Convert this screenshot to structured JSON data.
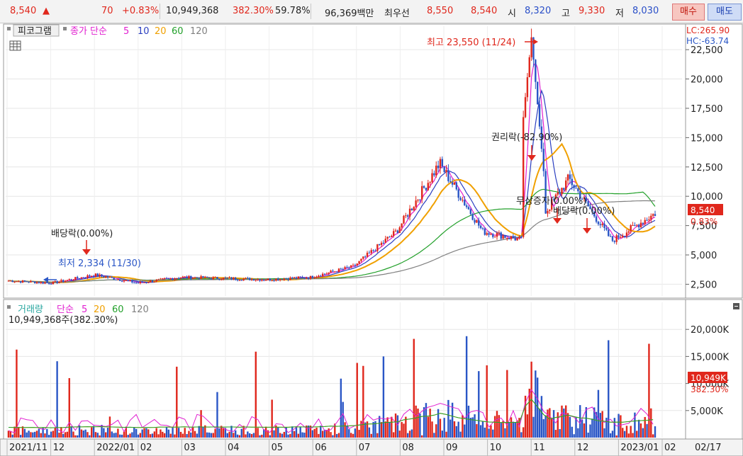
{
  "topbar": {
    "price": "8,540",
    "change": "70",
    "change_pct": "+0.83%",
    "volume": "10,949,368",
    "volume_ratio": "382.30%",
    "turnover": "59.78%",
    "amount": "96,369백만",
    "best_label": "최우선",
    "best_ask": "8,550",
    "best_bid": "8,540",
    "open_label": "시",
    "open": "8,320",
    "high_label": "고",
    "high": "9,330",
    "low_label": "저",
    "low": "8,030",
    "buy_label": "매수",
    "sell_label": "매도"
  },
  "price_panel": {
    "header": {
      "chart_name": "피코그램",
      "series_label": "종가 단순",
      "ma_periods": [
        "5",
        "10",
        "20",
        "60",
        "120"
      ]
    },
    "lc": "LC:265.90",
    "hc": "HC:-63.74",
    "current_price_tag": "8,540",
    "current_pct": "0.83%",
    "yaxis_ticks": [
      "22,500",
      "20,000",
      "17,500",
      "15,000",
      "12,500",
      "10,000",
      "7,500",
      "5,000",
      "2,500"
    ],
    "annotations": {
      "max_label": "최고 23,550 (11/24)",
      "min_label": "최저 2,334 (11/30)",
      "dividend1": "배당락(0.00%)",
      "rights": "권리락(-82.90%)",
      "bonus": "무상증자(0.00%)",
      "dividend2": "배당락(0.00%)"
    }
  },
  "volume_panel": {
    "header": {
      "title": "거래량",
      "series_label": "단순",
      "ma_periods": [
        "5",
        "20",
        "60",
        "120"
      ],
      "value_text": "10,949,368주(382.30%)"
    },
    "yaxis_ticks": [
      "20,000K",
      "15,000K",
      "10,000K",
      "5,000K"
    ],
    "current_volume_tag": "10,949K",
    "current_pct": "382.30%"
  },
  "xaxis": {
    "labels": [
      "2021/11",
      "12",
      "2022/01",
      "02",
      "03",
      "04",
      "05",
      "06",
      "07",
      "08",
      "09",
      "10",
      "11",
      "12",
      "2023/01",
      "02"
    ],
    "right_label": "02/17"
  },
  "colors": {
    "up": "#e0271c",
    "down": "#2a56c6",
    "ma5": "#e11fd0",
    "ma10": "#2b3fc0",
    "ma20": "#f0a000",
    "ma60": "#22a02a",
    "ma120": "#808080"
  },
  "chart_data": {
    "type": "line",
    "title": "피코그램",
    "x": [
      "2021/11",
      "12",
      "2022/01",
      "02",
      "03",
      "04",
      "05",
      "06",
      "07",
      "08",
      "09",
      "10",
      "11",
      "12",
      "2023/01",
      "02"
    ],
    "series": [
      {
        "name": "종가",
        "values": [
          2800,
          2600,
          3300,
          2600,
          3100,
          3000,
          2900,
          3100,
          4000,
          7000,
          12800,
          7000,
          6200,
          11500,
          6200,
          8540
        ]
      }
    ],
    "ylim": [
      1500,
      24500
    ],
    "ylabel": "",
    "xlabel": ""
  }
}
